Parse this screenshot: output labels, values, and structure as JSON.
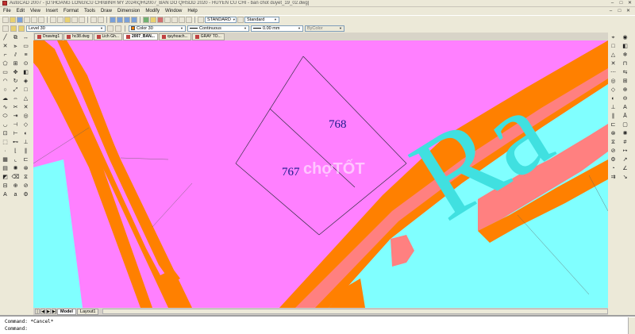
{
  "window": {
    "title": "AutoCAD 2007 - [D:\\HOANG LONG\\CU CHI\\BINH MY 2024\\QH\\2007_BAN DO QHSDD 2020 - HUYEN CU CHI - ban chot duyet_19_02.dwg]",
    "minimize": "–",
    "maximize": "□",
    "close": "✕"
  },
  "menu": [
    "File",
    "Edit",
    "View",
    "Insert",
    "Format",
    "Tools",
    "Draw",
    "Dimension",
    "Modify",
    "Window",
    "Help"
  ],
  "toolbar": {
    "text_style": "STANDARD",
    "dim_style": "Standard",
    "layer": "Level 30",
    "color": "Color 30",
    "linetype": "Continuous",
    "lineweight": "0.00 mm",
    "plotstyle": "ByColor"
  },
  "doc_tabs": [
    {
      "label": "Drawing1",
      "active": false
    },
    {
      "label": "hc38.dwg",
      "active": false
    },
    {
      "label": "Lich Gh...",
      "active": false
    },
    {
      "label": "2007_BAN...",
      "active": true
    },
    {
      "label": "quyhoach...",
      "active": false
    },
    {
      "label": "GRAY TO...",
      "active": false
    }
  ],
  "drawing": {
    "parcel_numbers": [
      "768",
      "767"
    ],
    "road_text": "Ra",
    "watermark": "chợTỐT",
    "colors": {
      "land_use_pink": "#ff80ff",
      "road_orange": "#ff8000",
      "water_cyan": "#80ffff",
      "buffer_red": "#ff8080",
      "text_blue": "#1a1a8c",
      "road_text": "#40e0e0"
    }
  },
  "layout_tabs": [
    {
      "label": "Model",
      "active": true
    },
    {
      "label": "Layout1",
      "active": false
    }
  ],
  "nav_arrows": [
    "|◀",
    "◀",
    "▶",
    "▶|"
  ],
  "command_line": {
    "line1": "Command: *Cancel*",
    "line2": "Command:"
  }
}
